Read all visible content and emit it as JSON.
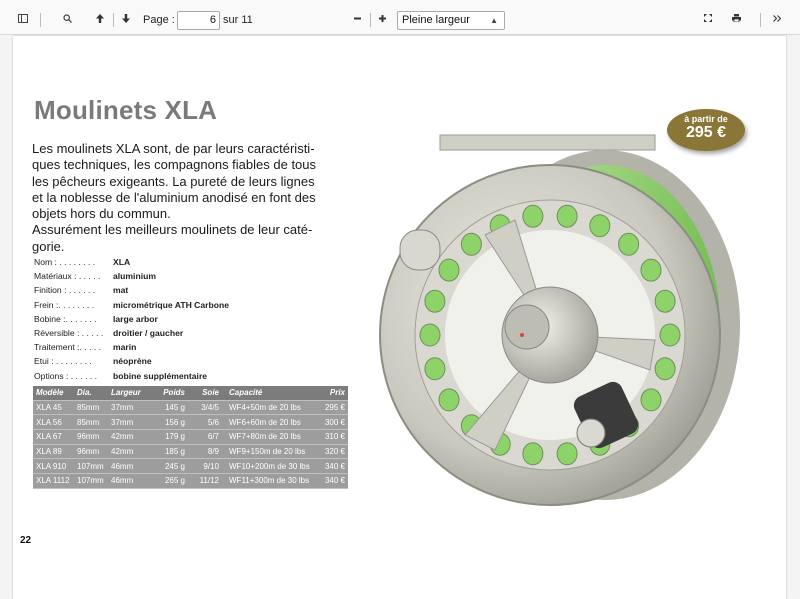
{
  "toolbar": {
    "page_label": "Page :",
    "page_value": "6",
    "page_total": "sur 11",
    "zoom_value": "Pleine largeur",
    "icons": [
      "sidebar-icon",
      "search-icon",
      "arrow-up-icon",
      "arrow-down-icon",
      "minus-icon",
      "plus-icon",
      "fullscreen-icon",
      "print-icon",
      "chevron-double-right-icon"
    ]
  },
  "document": {
    "title": "Moulinets XLA",
    "intro": "Les moulinets XLA sont, de par leurs caractéristi-ques techniques, les compagnons fiables de tous les pêcheurs exigeants. La pureté de leurs lignes et la noblesse de l'aluminium anodisé en font des objets hors du commun.\nAssurément les meilleurs moulinets de leur caté-gorie.",
    "specs": [
      {
        "key": "Nom : . . . . . . . .",
        "value": "XLA"
      },
      {
        "key": "Matériaux : . . . . .",
        "value": "aluminium"
      },
      {
        "key": "Finition : . . . . . .",
        "value": "mat"
      },
      {
        "key": "Frein :. . . . . . . .",
        "value": "micrométrique ATH Carbone"
      },
      {
        "key": "Bobine :. . . . . . .",
        "value": "large arbor"
      },
      {
        "key": "Réversible : . . . . .",
        "value": "droitier / gaucher"
      },
      {
        "key": "Traitement :. . . . .",
        "value": "marin"
      },
      {
        "key": "Etui : . . . . . . . .",
        "value": "néoprène"
      },
      {
        "key": "Options : . . . . . .",
        "value": "bobine supplémentaire"
      }
    ],
    "table": {
      "headers": [
        "Modèle",
        "Dia.",
        "Largeur",
        "Poids",
        "Soie",
        "Capacité",
        "Prix"
      ],
      "rows": [
        [
          "XLA 45",
          "85mm",
          "37mm",
          "145 g",
          "3/4/5",
          "WF4+50m de 20 lbs",
          "295 €"
        ],
        [
          "XLA 56",
          "85mm",
          "37mm",
          "156 g",
          "5/6",
          "WF6+60m de 20 lbs",
          "300 €"
        ],
        [
          "XLA 67",
          "96mm",
          "42mm",
          "179 g",
          "6/7",
          "WF7+80m de 20 lbs",
          "310 €"
        ],
        [
          "XLA 89",
          "96mm",
          "42mm",
          "185 g",
          "8/9",
          "WF9+150m de 20 lbs",
          "320 €"
        ],
        [
          "XLA 910",
          "107mm",
          "46mm",
          "245 g",
          "9/10",
          "WF10+200m de 30 lbs",
          "340 €"
        ],
        [
          "XLA 1112",
          "107mm",
          "46mm",
          "265 g",
          "11/12",
          "WF11+300m de 30 lbs",
          "340 €"
        ]
      ]
    },
    "badge_small": "à partir de",
    "badge_price": "295 €",
    "page_number": "22"
  },
  "colors": {
    "title_gray": "#7a7a7a",
    "badge_bronze": "#8a7636",
    "line_green": "#8ed36a",
    "table_gray": "#9d9d9d"
  }
}
